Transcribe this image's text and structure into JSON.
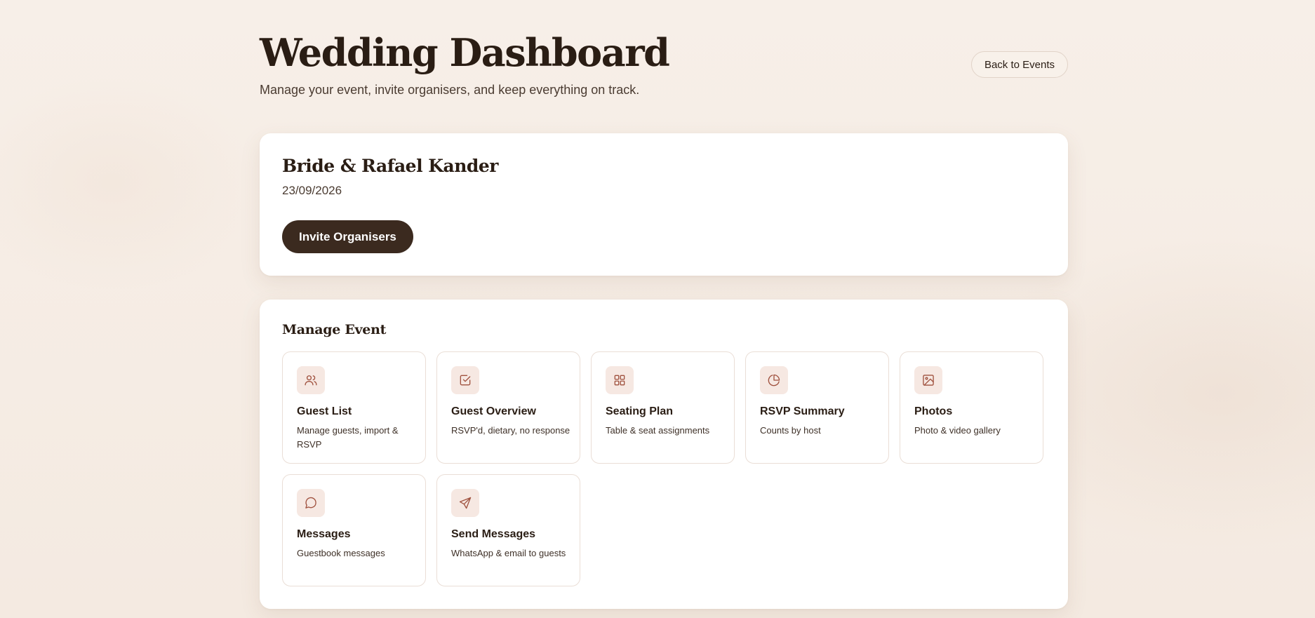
{
  "header": {
    "title": "Wedding Dashboard",
    "subtitle": "Manage your event, invite organisers, and keep everything on track.",
    "back_label": "Back to Events"
  },
  "event": {
    "name": "Bride & Rafael Kander",
    "date": "23/09/2026",
    "invite_label": "Invite Organisers"
  },
  "manage": {
    "title": "Manage Event",
    "tiles": [
      {
        "icon": "users-icon",
        "title": "Guest List",
        "desc": "Manage guests, import & RSVP"
      },
      {
        "icon": "check-square-icon",
        "title": "Guest Overview",
        "desc": "RSVP'd, dietary, no response"
      },
      {
        "icon": "grid-icon",
        "title": "Seating Plan",
        "desc": "Table & seat assignments"
      },
      {
        "icon": "pie-chart-icon",
        "title": "RSVP Summary",
        "desc": "Counts by host"
      },
      {
        "icon": "image-icon",
        "title": "Photos",
        "desc": "Photo & video gallery"
      },
      {
        "icon": "message-circle-icon",
        "title": "Messages",
        "desc": "Guestbook messages"
      },
      {
        "icon": "send-icon",
        "title": "Send Messages",
        "desc": "WhatsApp & email to guests"
      }
    ]
  },
  "colors": {
    "background": "#f6ede5",
    "accent": "#3b2a1f",
    "icon_color": "#a0523f",
    "icon_bg": "#f6e8e2"
  }
}
